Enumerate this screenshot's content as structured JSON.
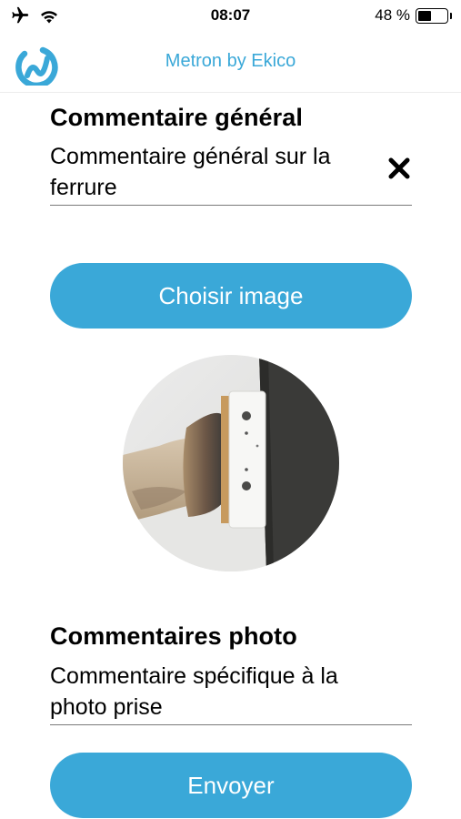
{
  "status_bar": {
    "time": "08:07",
    "battery_text": "48 %",
    "battery_level": 0.48,
    "icons": [
      "airplane-icon",
      "wifi-icon",
      "battery-icon"
    ]
  },
  "nav": {
    "title": "Metron by Ekico",
    "logo_icon": "metron-logo-icon"
  },
  "general_comment": {
    "title": "Commentaire général",
    "value": "Commentaire général sur la ferrure",
    "clear_icon": "close-icon"
  },
  "choose_image_button": {
    "label": "Choisir image"
  },
  "photo": {
    "icon": "hoof-photo"
  },
  "photo_comment": {
    "title": "Commentaires photo",
    "value": "Commentaire spécifique à la photo prise"
  },
  "send_button": {
    "label": "Envoyer"
  },
  "colors": {
    "accent": "#3aa8d8",
    "text": "#000000",
    "background": "#ffffff"
  }
}
